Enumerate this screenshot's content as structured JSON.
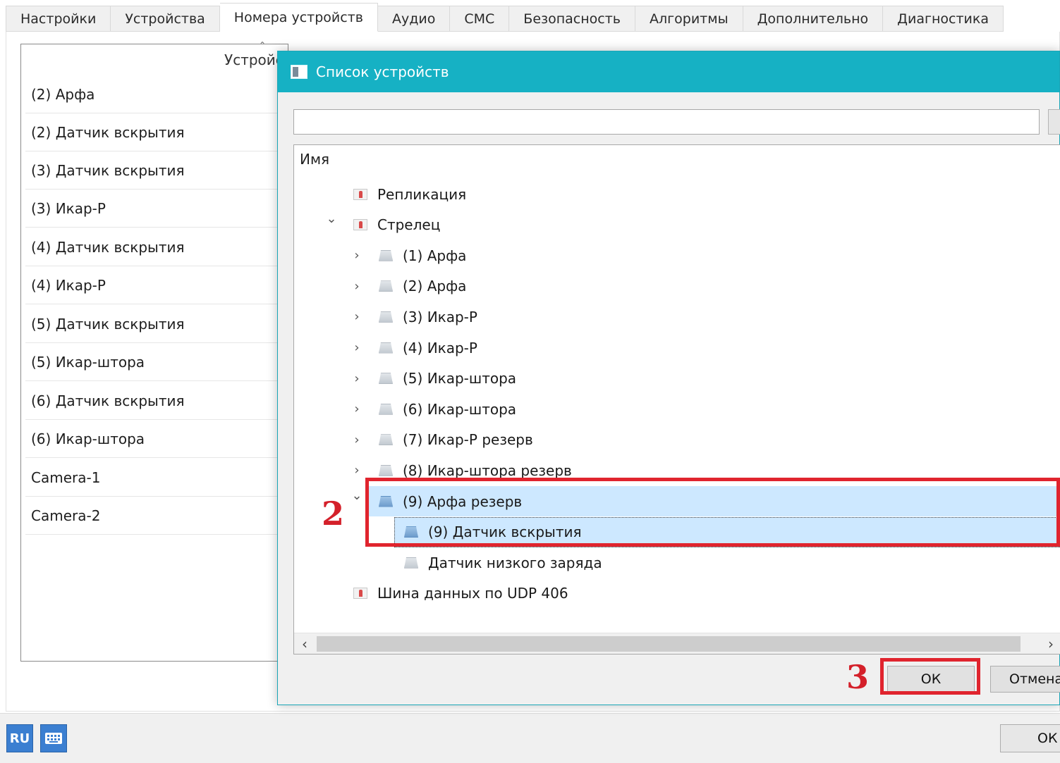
{
  "tabs": [
    {
      "label": "Настройки"
    },
    {
      "label": "Устройства"
    },
    {
      "label": "Номера устройств"
    },
    {
      "label": "Аудио"
    },
    {
      "label": "СМС"
    },
    {
      "label": "Безопасность"
    },
    {
      "label": "Алгоритмы"
    },
    {
      "label": "Дополнительно"
    },
    {
      "label": "Диагностика"
    }
  ],
  "active_tab": "Номера устройств",
  "device_list": {
    "header": "Устройс",
    "items": [
      "(2) Арфа",
      "(2) Датчик вскрытия",
      "(3) Датчик вскрытия",
      "(3) Икар-Р",
      "(4) Датчик вскрытия",
      "(4) Икар-Р",
      "(5) Датчик вскрытия",
      "(5) Икар-штора",
      "(6) Датчик вскрытия",
      "(6) Икар-штора",
      "Camera-1",
      "Camera-2"
    ]
  },
  "dialog": {
    "title": "Список устройств",
    "search": {
      "value": "",
      "placeholder": ""
    },
    "tree_header": "Имя",
    "tree": [
      {
        "label": "Репликация",
        "level": 0,
        "icon": "pin-icon",
        "toggle": ""
      },
      {
        "label": "Стрелец",
        "level": 0,
        "icon": "pin-icon",
        "toggle": "expanded"
      },
      {
        "label": "(1) Арфа",
        "level": 1,
        "icon": "device-icon",
        "toggle": "collapsed"
      },
      {
        "label": "(2) Арфа",
        "level": 1,
        "icon": "device-icon",
        "toggle": "collapsed"
      },
      {
        "label": "(3) Икар-Р",
        "level": 1,
        "icon": "device-icon",
        "toggle": "collapsed"
      },
      {
        "label": "(4) Икар-Р",
        "level": 1,
        "icon": "device-icon",
        "toggle": "collapsed"
      },
      {
        "label": "(5) Икар-штора",
        "level": 1,
        "icon": "device-icon",
        "toggle": "collapsed"
      },
      {
        "label": "(6) Икар-штора",
        "level": 1,
        "icon": "device-icon",
        "toggle": "collapsed"
      },
      {
        "label": "(7) Икар-Р резерв",
        "level": 1,
        "icon": "device-icon",
        "toggle": "collapsed"
      },
      {
        "label": "(8) Икар-штора резерв",
        "level": 1,
        "icon": "device-icon",
        "toggle": "collapsed"
      },
      {
        "label": "(9) Арфа резерв",
        "level": 1,
        "icon": "device-icon",
        "toggle": "expanded",
        "selected": true
      },
      {
        "label": "(9) Датчик вскрытия",
        "level": 2,
        "icon": "device-icon",
        "toggle": "",
        "selected": true,
        "focused": true
      },
      {
        "label": "Датчик низкого заряда",
        "level": 2,
        "icon": "device-icon",
        "toggle": ""
      },
      {
        "label": "Шина данных по UDP 406",
        "level": 0,
        "icon": "pin-icon",
        "toggle": ""
      }
    ],
    "ok_label": "ОК",
    "cancel_label": "Отмена"
  },
  "bottom_bar": {
    "language": "RU",
    "keyboard_icon": "keyboard-icon",
    "ok_label": "ОК"
  },
  "annotations": {
    "step_select": "2",
    "step_ok": "3",
    "color": "#e0242e"
  },
  "colors": {
    "dialog_titlebar": "#16b1c4",
    "selection": "#cde8ff",
    "lang_button": "#3b7fd1"
  }
}
